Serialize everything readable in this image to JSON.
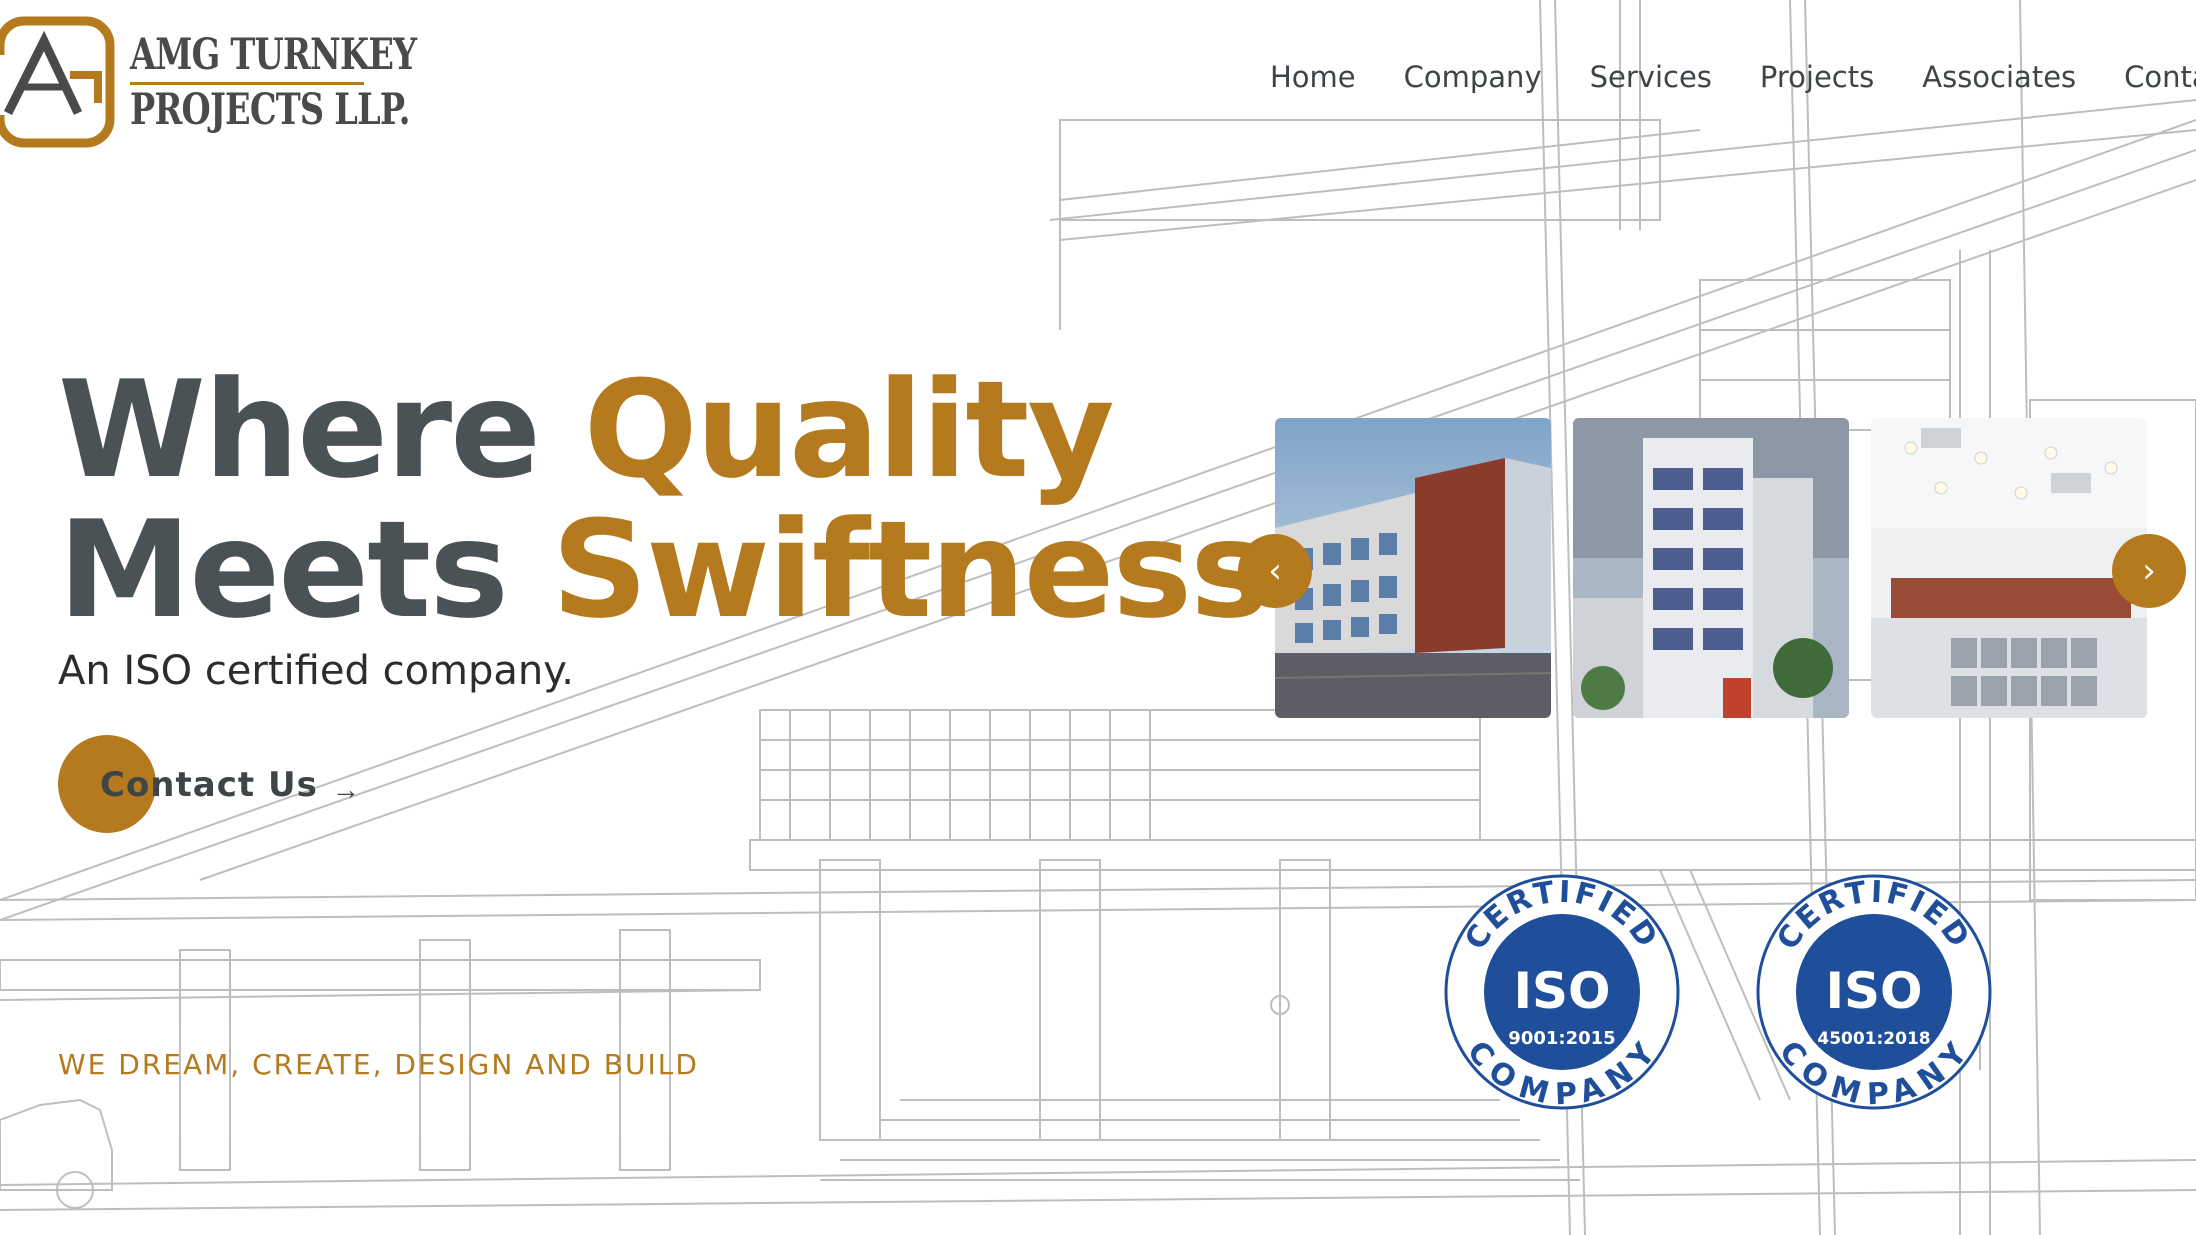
{
  "brand": {
    "name_line1": "AMG TURNKEY",
    "name_line2": "PROJECTS LLP.",
    "logo_letters": "AMG",
    "accent_color": "#b47a1d",
    "text_color": "#4a4a4a"
  },
  "nav": {
    "items": [
      "Home",
      "Company",
      "Services",
      "Projects",
      "Associates",
      "Contact"
    ]
  },
  "hero": {
    "title_part1": "Where ",
    "title_accent1": "Quality",
    "title_part2": "Meets ",
    "title_accent2": "Swiftness.",
    "subtitle": "An ISO certified company.",
    "cta_label": "Contact Us",
    "cta_icon": "arrow-right-icon",
    "tagline": "WE DREAM, CREATE, DESIGN AND BUILD"
  },
  "carousel": {
    "prev_icon": "chevron-left-icon",
    "next_icon": "chevron-right-icon",
    "prev_glyph": "‹",
    "next_glyph": "›",
    "slides": [
      "office-building-photo",
      "tower-building-photo",
      "interior-hall-photo"
    ]
  },
  "badges": [
    {
      "top": "CERTIFIED",
      "center": "ISO",
      "code": "9001:2015",
      "bottom": "COMPANY"
    },
    {
      "top": "CERTIFIED",
      "center": "ISO",
      "code": "45001:2018",
      "bottom": "COMPANY"
    }
  ],
  "colors": {
    "badge_blue": "#1f4e9a",
    "button": "#b47a1d"
  }
}
